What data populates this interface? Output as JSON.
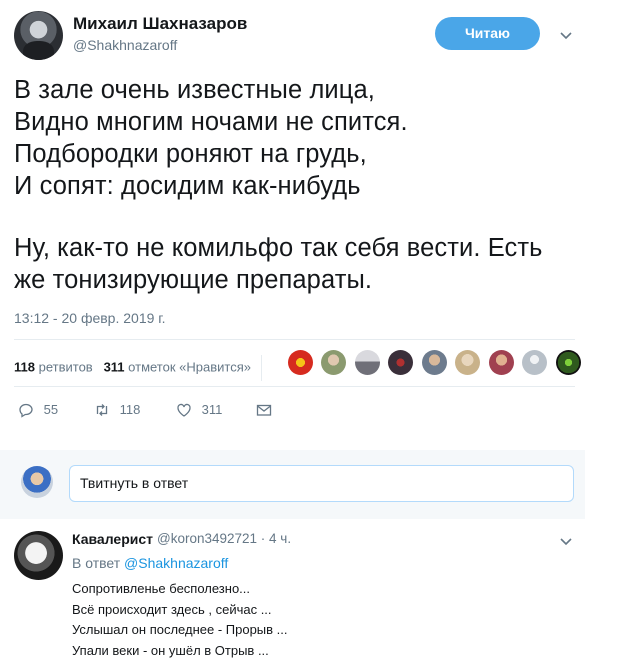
{
  "tweet": {
    "author_name": "Михаил Шахназаров",
    "author_handle": "@Shakhnazaroff",
    "follow_label": "Читаю",
    "lines": [
      "В зале очень известные лица,",
      "Видно многим ночами не спится.",
      "Подбородки роняют на грудь,",
      "И сопят: досидим как-нибудь"
    ],
    "lines2": [
      "Ну, как-то не комильфо так себя вести. Есть",
      "же тонизирующие препараты."
    ],
    "timestamp": "13:12 - 20 февр. 2019 г.",
    "stats": {
      "retweets_count": "118",
      "retweets_label": "ретвитов",
      "likes_count": "311",
      "likes_label": "отметок «Нравится»"
    },
    "likers": [
      {
        "icon": "emblem-avatar",
        "color": "#d62b1f"
      },
      {
        "icon": "person-avatar",
        "color": "#8b9a6f"
      },
      {
        "icon": "car-avatar",
        "color": "#a9a9b0"
      },
      {
        "icon": "dark-emblem-avatar",
        "color": "#3a2f3a"
      },
      {
        "icon": "person-avatar",
        "color": "#6d7b8d"
      },
      {
        "icon": "person-avatar",
        "color": "#c9b28a"
      },
      {
        "icon": "person-avatar",
        "color": "#a04050"
      },
      {
        "icon": "default-avatar",
        "color": "#b8c0c8"
      },
      {
        "icon": "green-avatar",
        "color": "#2f5a1e"
      }
    ],
    "actions": {
      "reply_count": "55",
      "retweet_count": "118",
      "like_count": "311"
    }
  },
  "reply_box": {
    "placeholder": "Твитнуть в ответ"
  },
  "reply": {
    "author_name": "Кавалерист",
    "meta": "@koron3492721 · 4 ч.",
    "reply_to_prefix": "В ответ",
    "reply_to_handle": "@Shakhnazaroff",
    "lines": [
      "Сопротивленье бесполезно...",
      "Всё происходит здесь , сейчас ...",
      "Услышал он последнее - Прорыв ...",
      "Упали веки - он ушёл в Отрыв ..."
    ]
  },
  "colors": {
    "accent": "#1b95e0",
    "follow_button": "#4aa6e8",
    "muted_text": "#657786",
    "divider": "#e6ecf0"
  }
}
